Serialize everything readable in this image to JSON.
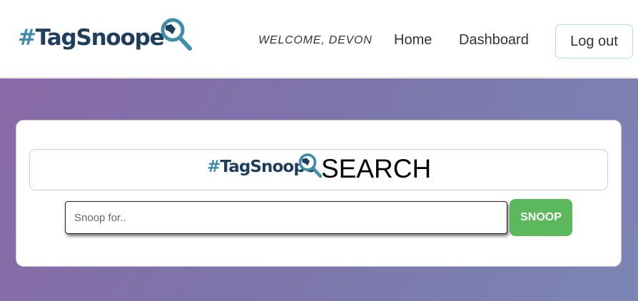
{
  "brand": {
    "hash": "#",
    "name": "TagSnoope"
  },
  "header": {
    "welcome": "WELCOME, DEVON",
    "nav": {
      "home": "Home",
      "dashboard": "Dashboard"
    },
    "logout_label": "Log out"
  },
  "search": {
    "title_suffix": "SEARCH",
    "placeholder": "Snoop for..",
    "value": "",
    "button_label": "SNOOP"
  },
  "colors": {
    "brand_teal": "#3f8cab",
    "brand_navy": "#1f3e5c",
    "button_green": "#5cb85c",
    "gradient_start": "#8a6aa8",
    "gradient_end": "#7c85b5"
  }
}
